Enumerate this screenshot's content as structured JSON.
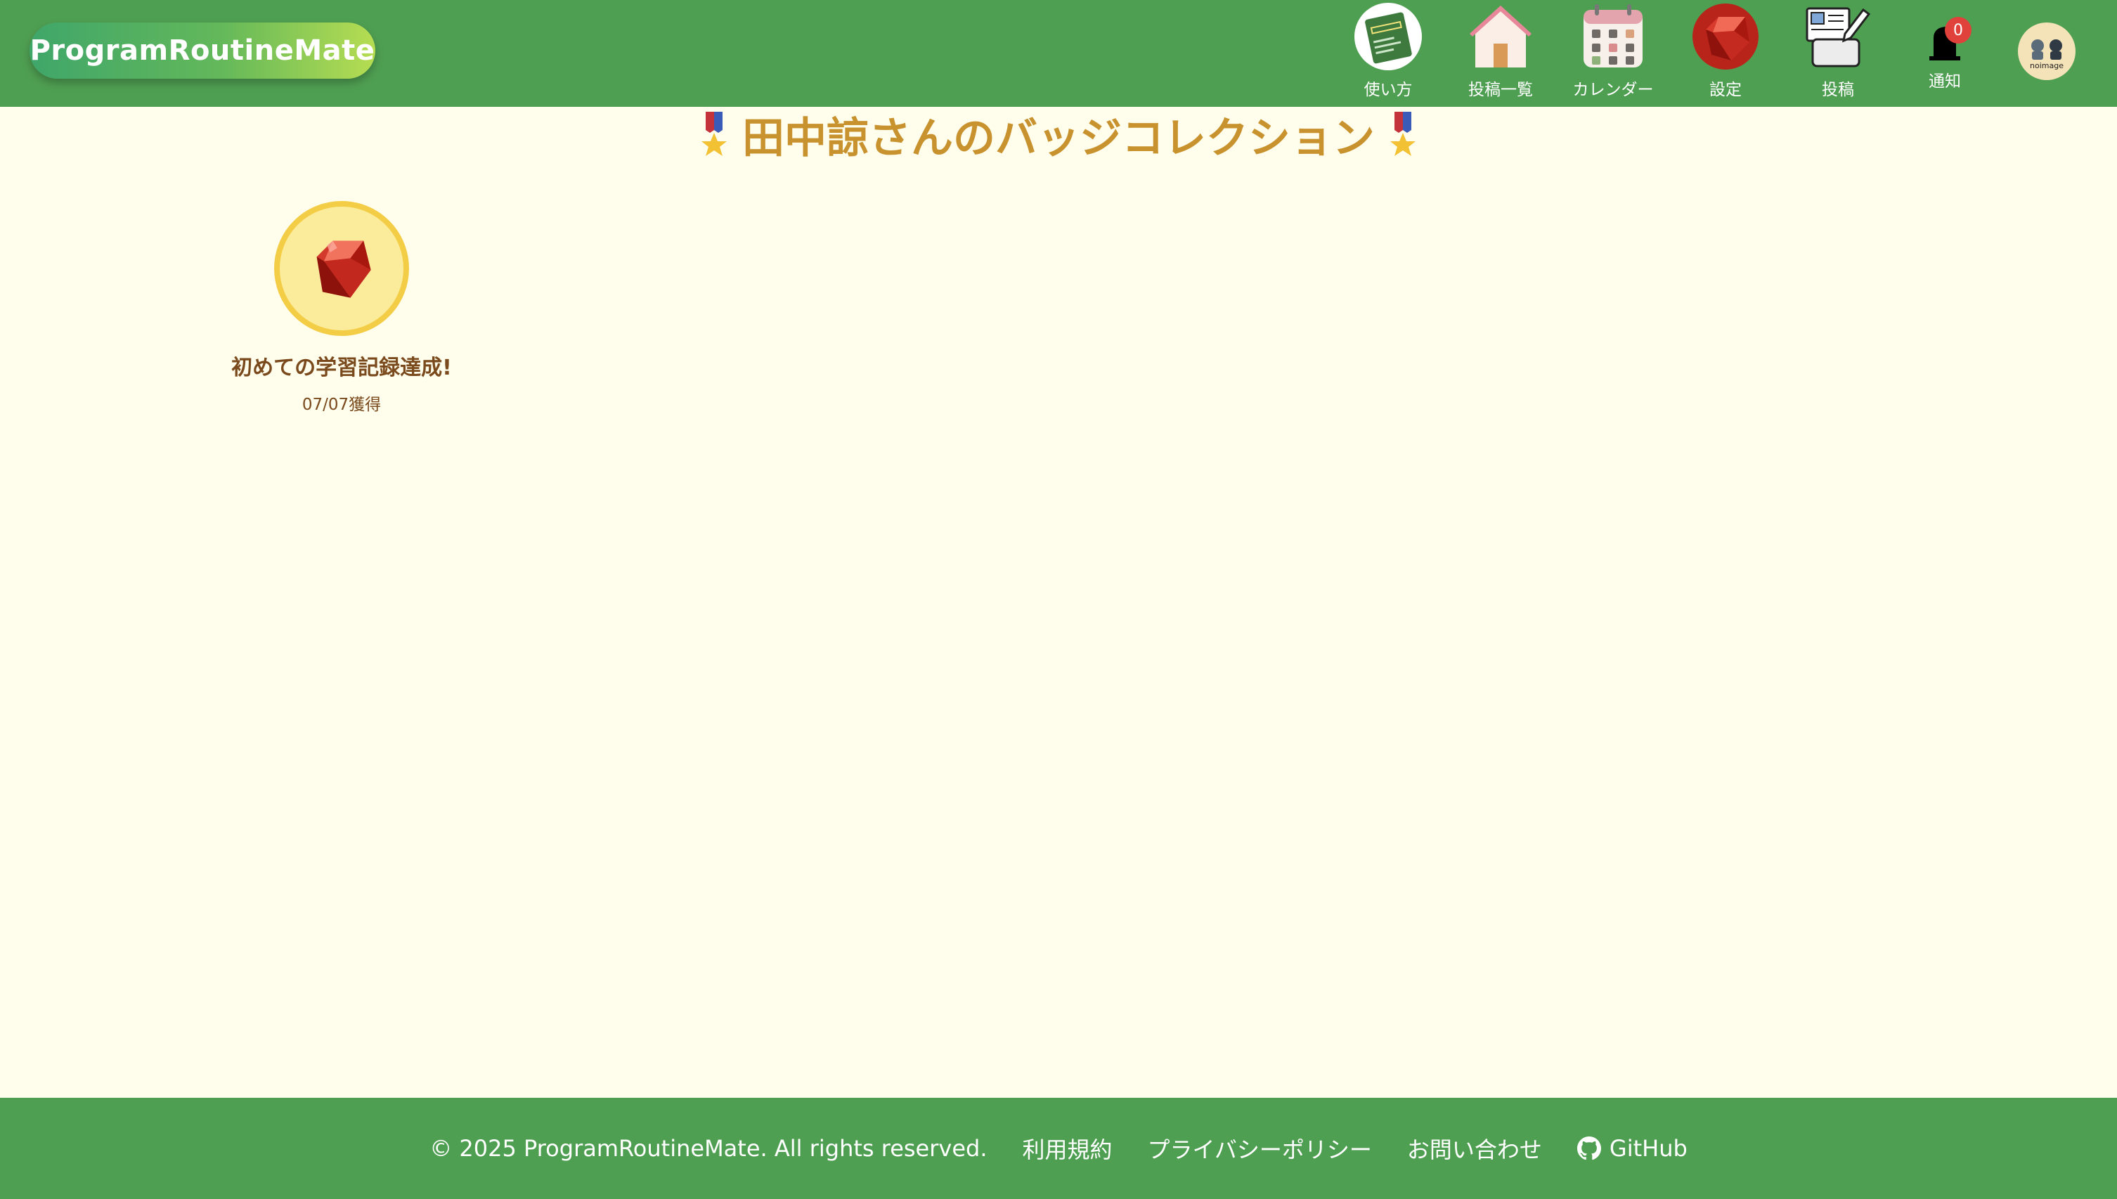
{
  "header": {
    "logo": "ProgramRoutineMate",
    "nav": [
      {
        "label": "使い方",
        "icon": "manual-book-icon"
      },
      {
        "label": "投稿一覧",
        "icon": "house-icon"
      },
      {
        "label": "カレンダー",
        "icon": "calendar-icon"
      },
      {
        "label": "設定",
        "icon": "ruby-gem-icon"
      },
      {
        "label": "投稿",
        "icon": "post-document-icon"
      }
    ],
    "notification": {
      "label": "通知",
      "count": "0",
      "icon": "bell-icon"
    },
    "avatar": {
      "icon": "user-avatar-icon",
      "text": "noimage"
    }
  },
  "main": {
    "title": "田中諒さんのバッジコレクション",
    "title_icon": "medal-icon",
    "badges": [
      {
        "name": "初めての学習記録達成!",
        "date": "07/07獲得",
        "icon": "ruby-gem-icon"
      }
    ]
  },
  "footer": {
    "copyright": "© 2025 ProgramRoutineMate. All rights reserved.",
    "links": [
      "利用規約",
      "プライバシーポリシー",
      "お問い合わせ"
    ],
    "github": "GitHub"
  },
  "colors": {
    "header_bg": "#4f9f52",
    "page_bg": "#fffdeb",
    "title": "#c8922e",
    "badge_text": "#7a4a1d",
    "badge_ring": "#f4cd47",
    "badge_fill": "#fbec9b",
    "notif_badge": "#e0413b"
  }
}
